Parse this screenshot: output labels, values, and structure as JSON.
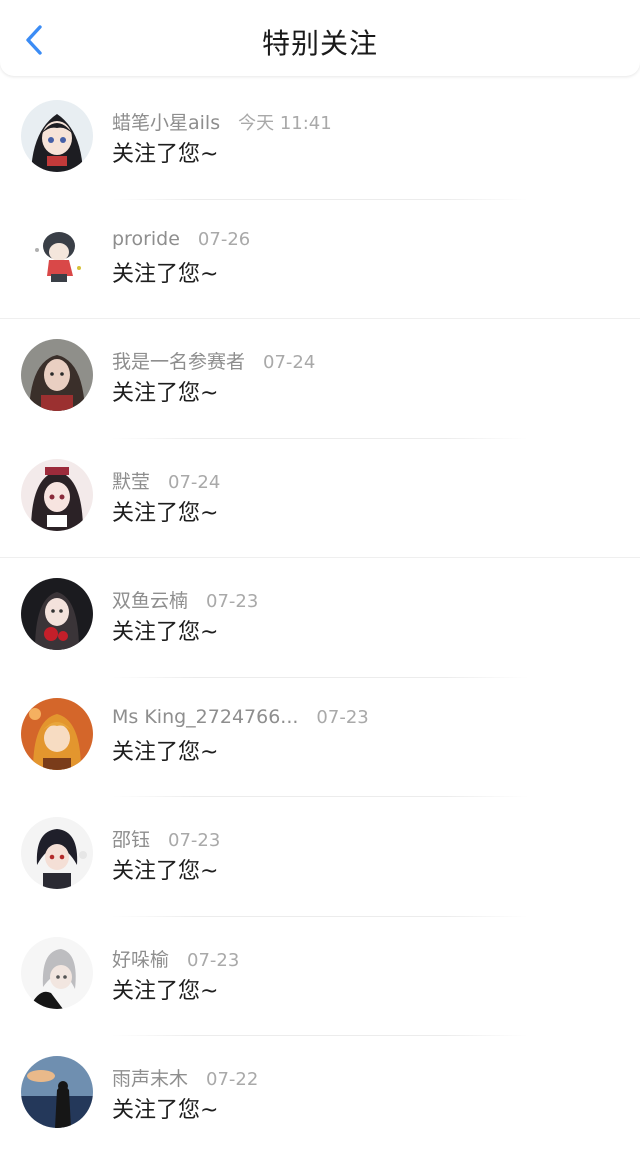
{
  "header": {
    "title": "特别关注",
    "back_icon": "chevron-left-icon",
    "accent_color": "#3b8cf5"
  },
  "items": [
    {
      "name": "蜡笔小星ails",
      "time": "今天 11:41",
      "message": "关注了您~"
    },
    {
      "name": "proride",
      "time": "07-26",
      "message": "关注了您~"
    },
    {
      "name": "我是一名参赛者",
      "time": "07-24",
      "message": "关注了您~"
    },
    {
      "name": "默莹",
      "time": "07-24",
      "message": "关注了您~"
    },
    {
      "name": "双鱼云楠",
      "time": "07-23",
      "message": "关注了您~"
    },
    {
      "name": "Ms King_2724766...",
      "time": "07-23",
      "message": "关注了您~"
    },
    {
      "name": "邵钰",
      "time": "07-23",
      "message": "关注了您~"
    },
    {
      "name": "好哚榆",
      "time": "07-23",
      "message": "关注了您~"
    },
    {
      "name": "雨声末木",
      "time": "07-22",
      "message": "关注了您~"
    }
  ]
}
